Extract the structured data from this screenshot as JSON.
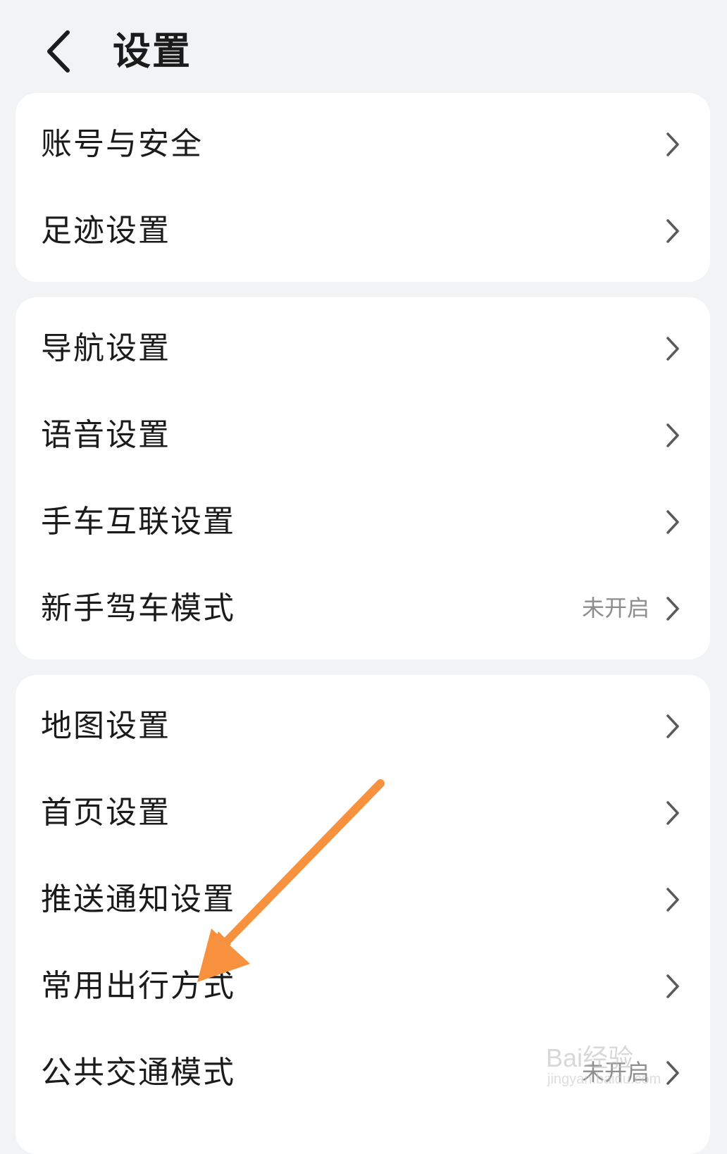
{
  "header": {
    "title": "设置"
  },
  "groups": [
    {
      "items": [
        {
          "label": "账号与安全"
        },
        {
          "label": "足迹设置"
        }
      ]
    },
    {
      "items": [
        {
          "label": "导航设置"
        },
        {
          "label": "语音设置"
        },
        {
          "label": "手车互联设置"
        },
        {
          "label": "新手驾车模式",
          "status": "未开启"
        }
      ]
    },
    {
      "items": [
        {
          "label": "地图设置"
        },
        {
          "label": "首页设置"
        },
        {
          "label": "推送通知设置"
        },
        {
          "label": "常用出行方式"
        },
        {
          "label": "公共交通模式",
          "status": "未开启"
        }
      ]
    }
  ],
  "annotation": {
    "arrow_color": "#f7913d",
    "points_to": "常用出行方式"
  },
  "watermark": {
    "text": "Bai经验",
    "sub": "jingyan.baidu.com"
  },
  "icons": {
    "back": "chevron-left-icon",
    "row": "chevron-right-icon"
  }
}
